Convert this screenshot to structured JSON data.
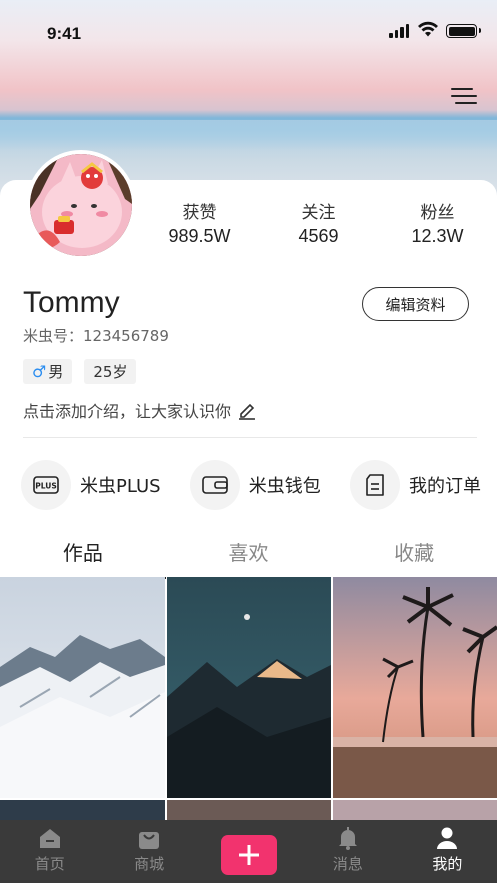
{
  "status_bar": {
    "time": "9:41"
  },
  "profile": {
    "name": "Tommy",
    "uid": "米虫号：123456789",
    "edit_label": "编辑资料",
    "gender": "男",
    "age": "25岁",
    "intro": "点击添加介绍，让大家认识你",
    "stats": [
      {
        "label": "获赞",
        "value": "989.5W"
      },
      {
        "label": "关注",
        "value": "4569"
      },
      {
        "label": "粉丝",
        "value": "12.3W"
      }
    ]
  },
  "quick_actions": [
    {
      "label": "米虫PLUS",
      "icon": "plus-badge-icon"
    },
    {
      "label": "米虫钱包",
      "icon": "wallet-icon"
    },
    {
      "label": "我的订单",
      "icon": "order-icon"
    }
  ],
  "tabs": [
    {
      "label": "作品",
      "active": true
    },
    {
      "label": "喜欢",
      "active": false
    },
    {
      "label": "收藏",
      "active": false
    }
  ],
  "tabbar": [
    {
      "label": "首页",
      "icon": "home-icon",
      "active": false
    },
    {
      "label": "商城",
      "icon": "shop-bag-icon",
      "active": false
    },
    {
      "label": "",
      "icon": "add-icon",
      "active": false
    },
    {
      "label": "消息",
      "icon": "bell-icon",
      "active": false
    },
    {
      "label": "我的",
      "icon": "user-icon",
      "active": true
    }
  ],
  "colors": {
    "accent": "#f2336e",
    "tabbar_bg": "#3a3a3a",
    "male": "#2a8df0"
  }
}
